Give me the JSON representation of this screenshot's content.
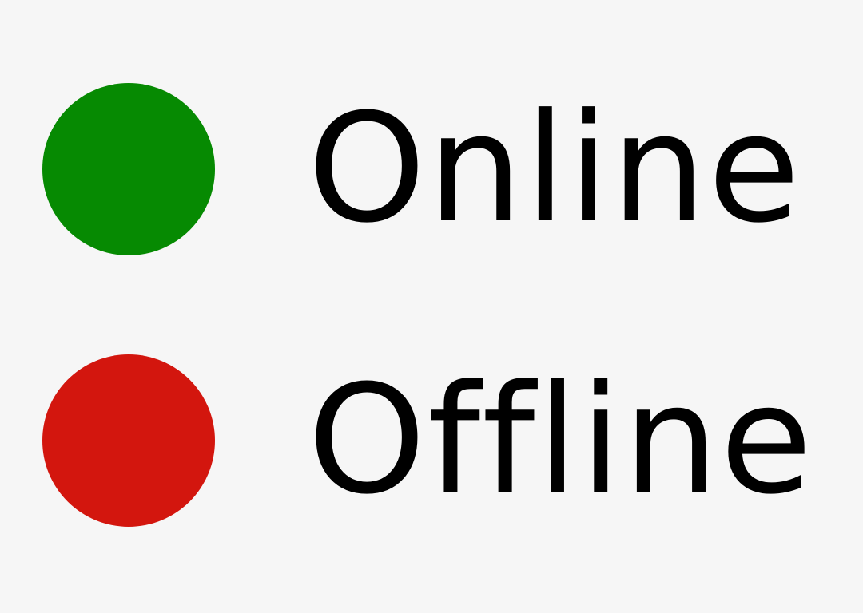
{
  "statuses": [
    {
      "label": "Online",
      "color": "#068a02",
      "icon": "green-status-dot-icon"
    },
    {
      "label": "Offline",
      "color": "#d3160e",
      "icon": "red-status-dot-icon"
    }
  ]
}
